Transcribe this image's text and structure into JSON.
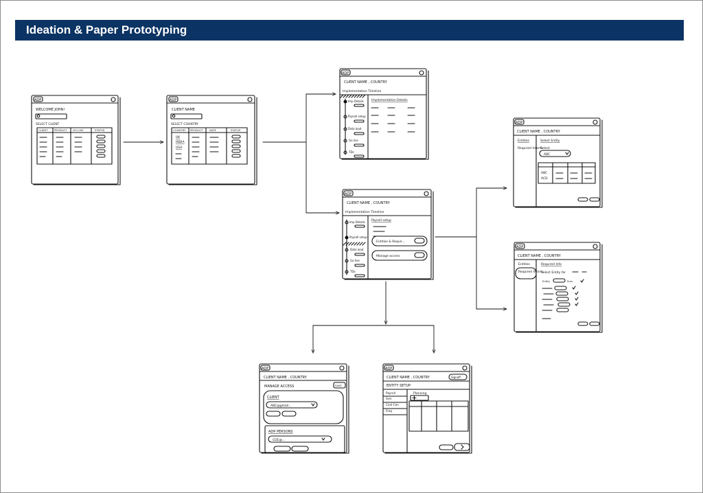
{
  "page_title": "Ideation & Paper Prototyping",
  "colors": {
    "banner": "#0b3363",
    "banner_text": "#ffffff",
    "ink": "#111111"
  },
  "screens": {
    "home": {
      "app": "ADP",
      "welcome": "WELCOME JOHN!",
      "section": "SELECT CLIENT",
      "columns": [
        "CLIENT",
        "PRODUCT",
        "GO-LIVE",
        "STATUS"
      ]
    },
    "client": {
      "app": "ADP",
      "title": "CLIENT NAME",
      "section": "SELECT COUNTRY",
      "columns": [
        "COUNTRY",
        "PRODUCT",
        "DATE",
        "STATUS"
      ],
      "countries": [
        "UK",
        "INDIA",
        "USA"
      ]
    },
    "timeline_details": {
      "app": "ADP",
      "title": "CLIENT NAME , COUNTRY",
      "timeline_label": "Implementation Timeline",
      "steps": [
        "Imp Details",
        "Payroll setup",
        "Data load",
        "Go live",
        "TDs"
      ],
      "panel_title": "Implementation Details"
    },
    "timeline_payroll": {
      "app": "ADP",
      "title": "CLIENT NAME , COUNTRY",
      "timeline_label": "Implementation Timeline",
      "steps": [
        "Imp Details",
        "Payroll setup",
        "Data load",
        "Go live",
        "TDs"
      ],
      "panel_title": "Payroll setup",
      "actions": [
        "Entities & Requir...",
        "Manage access"
      ]
    },
    "entities": {
      "app": "ADP",
      "title": "CLIENT NAME , COUNTRY",
      "nav": [
        "Entities",
        "Required Inform"
      ],
      "panel_title": "Select Entity",
      "select_label": "Select",
      "select_value": "ABC",
      "rows": [
        "ABC",
        "ACD"
      ]
    },
    "required_info": {
      "app": "ADP",
      "title": "CLIENT NAME , COUNTRY",
      "nav": [
        "Entities",
        "Required Inform"
      ],
      "panel_title": "Required Info",
      "select_label": "Select Entity for",
      "field_labels": [
        "Entity",
        "Sum"
      ]
    },
    "manage_access": {
      "app": "ADP",
      "title": "CLIENT NAME , COUNTRY",
      "heading": "MANAGE ACCESS",
      "save": "SAVE",
      "client_section": "CLIENT",
      "client_value": "ABC@gmail...",
      "adp_section": "ADP PERSONS",
      "adp_value": "CDE@..."
    },
    "entity_setup": {
      "app": "ADP",
      "title": "CLIENT NAME , COUNTRY",
      "badge": "Signoff",
      "heading": "ENTITY SETUP",
      "side_items": [
        "Payroll",
        "Gen",
        "Cost Cen",
        "Freq"
      ],
      "panel_title": "Planning"
    }
  }
}
